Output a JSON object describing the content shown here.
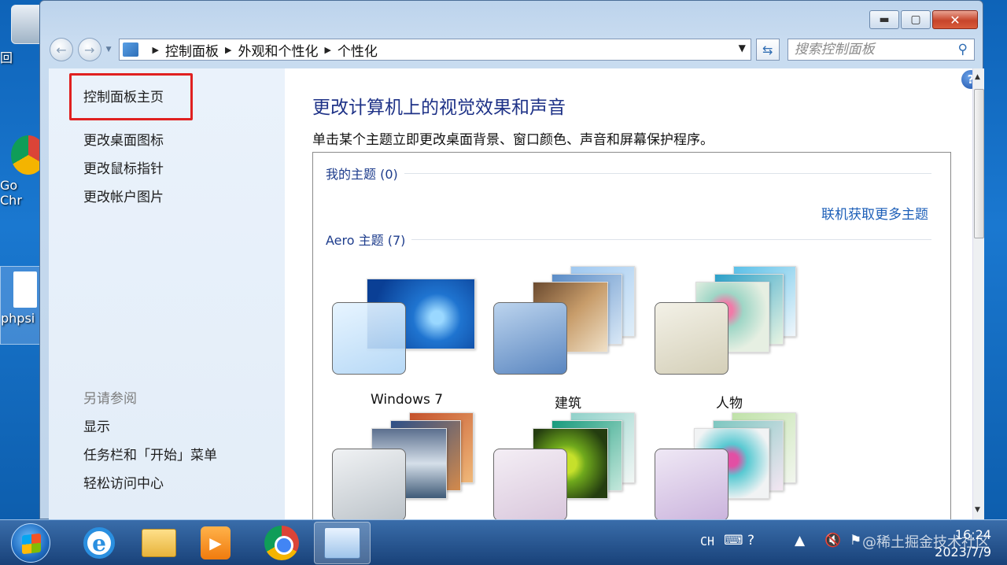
{
  "desktop": {
    "icons": [
      {
        "label": "回",
        "icon": "recycle-bin-icon"
      },
      {
        "label": "Go\nChr",
        "icon": "chrome-icon"
      },
      {
        "label": "phpsi",
        "icon": "shortcut-icon"
      }
    ]
  },
  "window": {
    "controls": {
      "minimize": "▬",
      "maximize": "▢",
      "close": "✕"
    },
    "nav": {
      "back": "←",
      "forward": "→"
    },
    "breadcrumbs": [
      "控制面板",
      "外观和个性化",
      "个性化"
    ],
    "search_placeholder": "搜索控制面板"
  },
  "leftpane": {
    "home": "控制面板主页",
    "links": [
      "更改桌面图标",
      "更改鼠标指针",
      "更改帐户图片"
    ],
    "see_also_title": "另请参阅",
    "see_also": [
      "显示",
      "任务栏和「开始」菜单",
      "轻松访问中心"
    ],
    "highlight_color": "#e02020"
  },
  "content": {
    "title": "更改计算机上的视觉效果和声音",
    "description": "单击某个主题立即更改桌面背景、窗口颜色、声音和屏幕保护程序。",
    "my_themes": "我的主题 (0)",
    "online_link": "联机获取更多主题",
    "aero_themes": "Aero 主题 (7)",
    "themes": [
      {
        "name": "Windows 7"
      },
      {
        "name": "建筑"
      },
      {
        "name": "人物"
      },
      {
        "name": ""
      },
      {
        "name": ""
      },
      {
        "name": ""
      }
    ]
  },
  "taskbar": {
    "apps": [
      "internet-explorer-icon",
      "folder-icon",
      "media-player-icon",
      "chrome-icon",
      "control-panel-icon"
    ],
    "language": "CH",
    "time": "16:24",
    "date": "2023/7/9",
    "watermark": "@稀土掘金技术社区"
  }
}
